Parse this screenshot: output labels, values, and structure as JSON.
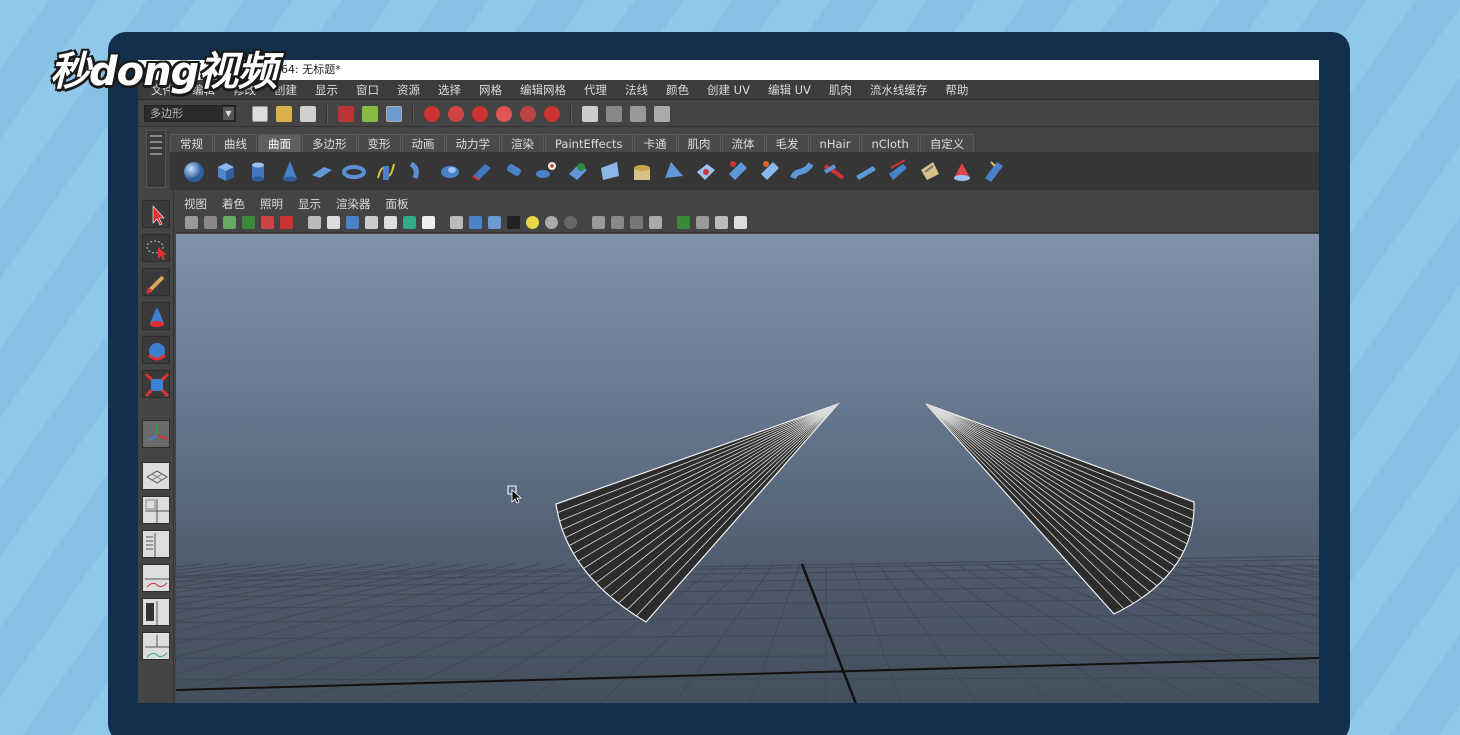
{
  "logo": {
    "text": "秒dong视频"
  },
  "window": {
    "title": "014 x64: 无标题*"
  },
  "menu": [
    "文件",
    "编辑",
    "修改",
    "创建",
    "显示",
    "窗口",
    "资源",
    "选择",
    "网格",
    "编辑网格",
    "代理",
    "法线",
    "颜色",
    "创建 UV",
    "编辑 UV",
    "肌肉",
    "流水线缓存",
    "帮助"
  ],
  "status_line": {
    "mode": "多边形"
  },
  "shelf": {
    "tabs": [
      "常规",
      "曲线",
      "曲面",
      "多边形",
      "变形",
      "动画",
      "动力学",
      "渲染",
      "PaintEffects",
      "卡通",
      "肌肉",
      "流体",
      "毛发",
      "nHair",
      "nCloth",
      "自定义"
    ],
    "active_tab": "曲面"
  },
  "panel": {
    "menu": [
      "视图",
      "着色",
      "照明",
      "显示",
      "渲染器",
      "面板"
    ]
  },
  "colors": {
    "accent_red": "#c8302a",
    "accent_blue": "#3d7fd0",
    "viewport_top": "#7f92aa",
    "viewport_bottom": "#43505e"
  },
  "viewport": {
    "objects": [
      "nurbs-cone-left",
      "nurbs-cone-right"
    ]
  }
}
